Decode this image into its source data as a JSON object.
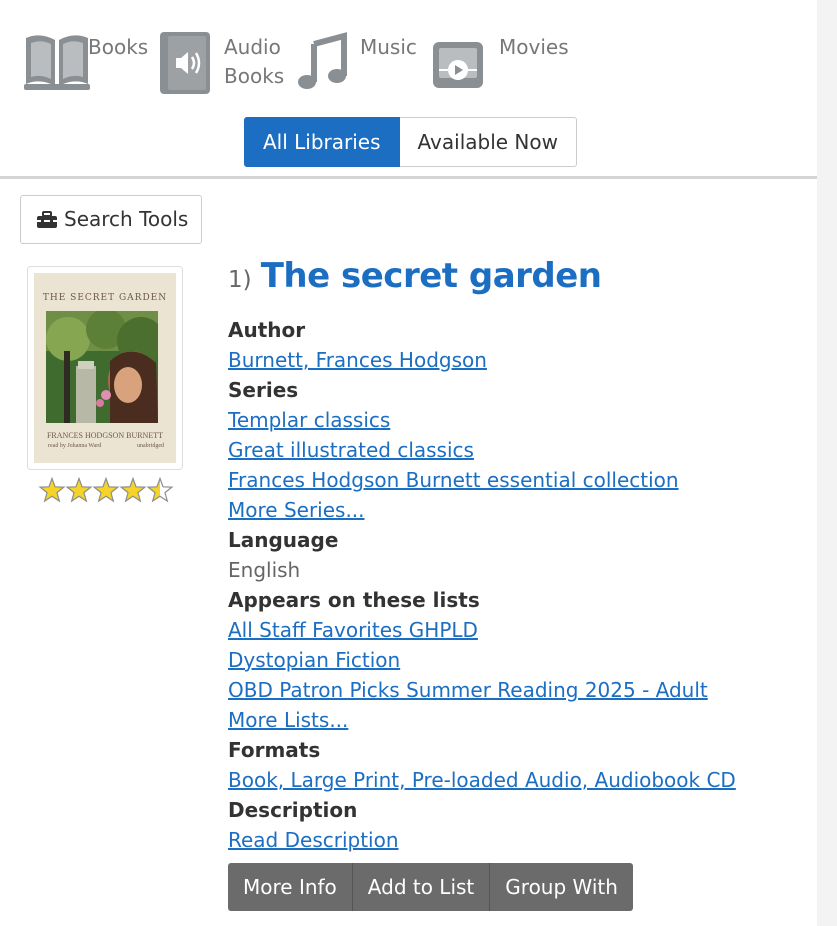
{
  "formats": {
    "books": {
      "label": "Books",
      "icon": "book-icon"
    },
    "audio_books": {
      "label_line1": "Audio",
      "label_line2": "Books",
      "icon": "audiobook-icon"
    },
    "music": {
      "label": "Music",
      "icon": "music-note-icon"
    },
    "movies": {
      "label": "Movies",
      "icon": "movie-icon"
    }
  },
  "library_toggle": {
    "all_libraries": "All Libraries",
    "available_now": "Available Now",
    "active": "All Libraries"
  },
  "search_tools": {
    "label": "Search Tools",
    "icon": "toolbox-icon"
  },
  "result": {
    "number": "1)",
    "title": "The secret garden",
    "cover": {
      "title_text": "THE SECRET GARDEN",
      "author_text": "FRANCES HODGSON BURNETT",
      "reader_text": "read by Johanna Ward",
      "edition_text": "unabridged"
    },
    "rating": 4.5,
    "author_label": "Author",
    "author": "Burnett, Frances Hodgson",
    "series_label": "Series",
    "series": [
      "Templar classics",
      "Great illustrated classics",
      "Frances Hodgson Burnett essential collection"
    ],
    "more_series": "More Series...",
    "language_label": "Language",
    "language": "English",
    "lists_label": "Appears on these lists",
    "lists": [
      "All Staff Favorites GHPLD",
      "Dystopian Fiction",
      "OBD Patron Picks Summer Reading 2025 - Adult"
    ],
    "more_lists": "More Lists...",
    "formats_label": "Formats",
    "formats": "Book, Large Print, Pre-loaded Audio, Audiobook CD",
    "description_label": "Description",
    "description_link": "Read Description",
    "actions": [
      "More Info",
      "Add to List",
      "Group With"
    ]
  },
  "colors": {
    "accent": "#1b6ec2",
    "icon_gray": "#8a8f93",
    "button_gray": "#6b6b6b",
    "star": "#f5d327"
  }
}
